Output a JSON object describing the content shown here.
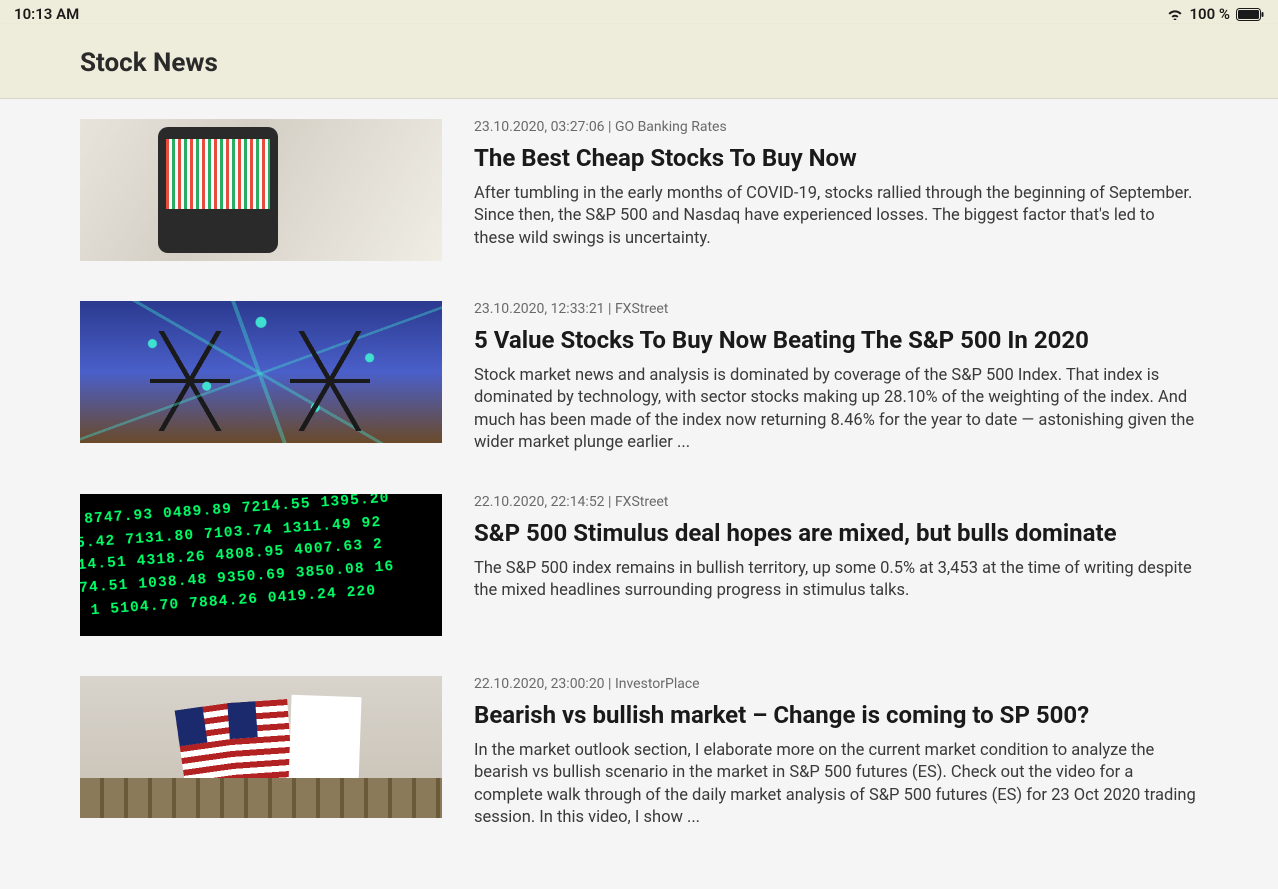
{
  "status": {
    "time": "10:13 AM",
    "battery_percent": "100 %"
  },
  "header": {
    "title": "Stock News"
  },
  "articles": [
    {
      "date": "23.10.2020",
      "time": "03:27:06",
      "source": "GO Banking Rates",
      "title": "The Best Cheap Stocks To Buy Now",
      "summary": "After tumbling in the early months of COVID-19, stocks rallied through the beginning of September. Since then, the S&P 500 and Nasdaq have experienced losses. The biggest factor that's led to these wild swings is uncertainty.",
      "thumb_name": "phone-stock-chart-image"
    },
    {
      "date": "23.10.2020",
      "time": "12:33:21",
      "source": "FXStreet",
      "title": "5 Value Stocks To Buy Now Beating The S&P 500 In 2020",
      "summary": "Stock market news and analysis is dominated by coverage of the S&P 500 Index. That index is dominated by technology, with sector stocks making up 28.10% of the weighting of the index. And much has been made of the index now returning 8.46% for the year to date — astonishing given the wider market plunge earlier ...",
      "thumb_name": "power-grid-network-image"
    },
    {
      "date": "22.10.2020",
      "time": "22:14:52",
      "source": "FXStreet",
      "title": "S&P 500 Stimulus deal hopes are mixed, but bulls dominate",
      "summary": "The S&P 500 index remains in bullish territory, up some 0.5% at 3,453 at the time of writing despite the mixed headlines surrounding progress in stimulus talks.",
      "thumb_name": "stock-ticker-numbers-image"
    },
    {
      "date": "22.10.2020",
      "time": "23:00:20",
      "source": "InvestorPlace",
      "title": "Bearish vs bullish market – Change is coming to SP 500?",
      "summary": "In the market outlook section, I elaborate more on the current market condition to analyze the bearish vs bullish scenario in the market in S&P 500 futures (ES). Check out the video for a complete walk through of the daily market analysis of S&P 500 futures (ES) for 23 Oct 2020 trading session. In this video, I show ...",
      "thumb_name": "nyse-flags-image"
    }
  ]
}
